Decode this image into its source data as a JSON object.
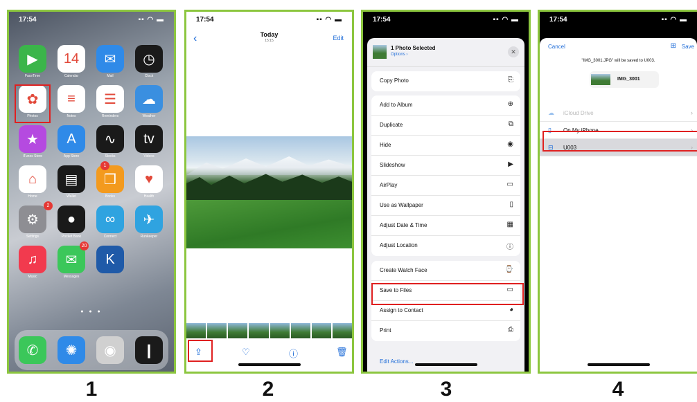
{
  "steps": [
    "1",
    "2",
    "3",
    "4"
  ],
  "home": {
    "time": "17:54",
    "apps": [
      {
        "label": "FaceTime",
        "color": "#3bb54a",
        "glyph": "▶"
      },
      {
        "label": "Calendar",
        "color": "#ffffff",
        "glyph": "14"
      },
      {
        "label": "Mail",
        "color": "#2f8ae8",
        "glyph": "✉"
      },
      {
        "label": "Clock",
        "color": "#1a1a1a",
        "glyph": "◷"
      },
      {
        "label": "Photos",
        "color": "#ffffff",
        "glyph": "✿"
      },
      {
        "label": "Notes",
        "color": "#ffffff",
        "glyph": "≡"
      },
      {
        "label": "Reminders",
        "color": "#ffffff",
        "glyph": "☰"
      },
      {
        "label": "Weather",
        "color": "#3a8fe0",
        "glyph": "☁"
      },
      {
        "label": "iTunes Store",
        "color": "#b54ae0",
        "glyph": "★"
      },
      {
        "label": "App Store",
        "color": "#2f8ae8",
        "glyph": "A"
      },
      {
        "label": "Stocks",
        "color": "#1a1a1a",
        "glyph": "∿"
      },
      {
        "label": "Videos",
        "color": "#1a1a1a",
        "glyph": "tv"
      },
      {
        "label": "Home",
        "color": "#ffffff",
        "glyph": "⌂"
      },
      {
        "label": "Wallet",
        "color": "#1a1a1a",
        "glyph": "▤"
      },
      {
        "label": "Books",
        "color": "#f39a1e",
        "glyph": "❒"
      },
      {
        "label": "Health",
        "color": "#ffffff",
        "glyph": "♥"
      },
      {
        "label": "Settings",
        "color": "#8e8e93",
        "glyph": "⚙"
      },
      {
        "label": "Pocket Bank",
        "color": "#1a1a1a",
        "glyph": "●"
      },
      {
        "label": "Connect",
        "color": "#2fa3e0",
        "glyph": "∞"
      },
      {
        "label": "Runkeeper",
        "color": "#2fa3e0",
        "glyph": "✈"
      },
      {
        "label": "Music",
        "color": "#f23a4e",
        "glyph": "♫"
      },
      {
        "label": "Messages",
        "color": "#3bc75a",
        "glyph": "✉"
      },
      {
        "label": "",
        "color": "#1f5aa8",
        "glyph": "K"
      }
    ],
    "badges": {
      "wallet": "1",
      "settings": "2",
      "messages": "20"
    },
    "dock": [
      {
        "color": "#3bc75a",
        "glyph": "✆"
      },
      {
        "color": "#2f8ae8",
        "glyph": "✺"
      },
      {
        "color": "#d0d0d0",
        "glyph": "◉"
      },
      {
        "color": "#1a1a1a",
        "glyph": "❙"
      }
    ]
  },
  "photos": {
    "time": "17:54",
    "back": "‹",
    "title": "Today",
    "subtitle": "15:15",
    "edit": "Edit",
    "toolbar": [
      "share-icon",
      "heart-icon",
      "info-icon",
      "trash-icon"
    ]
  },
  "share_sheet": {
    "time": "17:54",
    "title": "1 Photo Selected",
    "options": "Options ›",
    "close": "✕",
    "copy": {
      "label": "Copy Photo",
      "icon": "⎘"
    },
    "actions": [
      {
        "label": "Add to Album",
        "icon": "⊕"
      },
      {
        "label": "Duplicate",
        "icon": "⧉"
      },
      {
        "label": "Hide",
        "icon": "◉"
      },
      {
        "label": "Slideshow",
        "icon": "▶"
      },
      {
        "label": "AirPlay",
        "icon": "▭"
      },
      {
        "label": "Use as Wallpaper",
        "icon": "▯"
      },
      {
        "label": "Adjust Date & Time",
        "icon": "▦"
      },
      {
        "label": "Adjust Location",
        "icon": "ⓘ"
      }
    ],
    "more": [
      {
        "label": "Create Watch Face",
        "icon": "⌚"
      },
      {
        "label": "Save to Files",
        "icon": "▭"
      },
      {
        "label": "Assign to Contact",
        "icon": "◕"
      },
      {
        "label": "Print",
        "icon": "⎙"
      }
    ],
    "edit_actions": "Edit Actions..."
  },
  "save_to_files": {
    "time": "17:54",
    "cancel": "Cancel",
    "save": "Save",
    "message": "\"IMG_3001.JPG\" will be saved to U003.",
    "file_name": "IMG_3001",
    "locations": [
      {
        "label": "iCloud Drive",
        "icon": "☁",
        "muted": true
      },
      {
        "label": "On My iPhone",
        "icon": "▯",
        "muted": false
      },
      {
        "label": "U003",
        "icon": "⊟",
        "muted": false
      }
    ]
  }
}
